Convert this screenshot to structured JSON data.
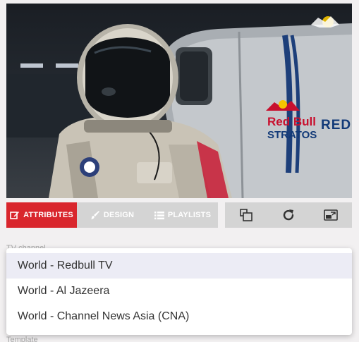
{
  "video": {
    "brand_red": "Red Bull",
    "brand_stratos": "STRATOS",
    "brand_side": "REDB",
    "badge_icon": "redbull-logo-icon"
  },
  "toolbar": {
    "tabs": [
      {
        "label": "ATTRIBUTES",
        "icon": "edit-icon",
        "active": true
      },
      {
        "label": "DESIGN",
        "icon": "brush-icon",
        "active": false
      },
      {
        "label": "PLAYLISTS",
        "icon": "list-icon",
        "active": false
      }
    ],
    "tools": [
      {
        "icon": "layers-icon"
      },
      {
        "icon": "refresh-icon"
      },
      {
        "icon": "picture-in-picture-icon"
      }
    ]
  },
  "fields": {
    "tv_channel_label": "TV channel",
    "template_label": "Template"
  },
  "dropdown": {
    "options": [
      "World - Redbull TV",
      "World - Al Jazeera",
      "World - Channel News Asia (CNA)"
    ],
    "highlighted_index": 0
  },
  "colors": {
    "accent": "#d9262d",
    "toolbar_bg": "#d4d4d4",
    "highlight": "#ececf5"
  }
}
